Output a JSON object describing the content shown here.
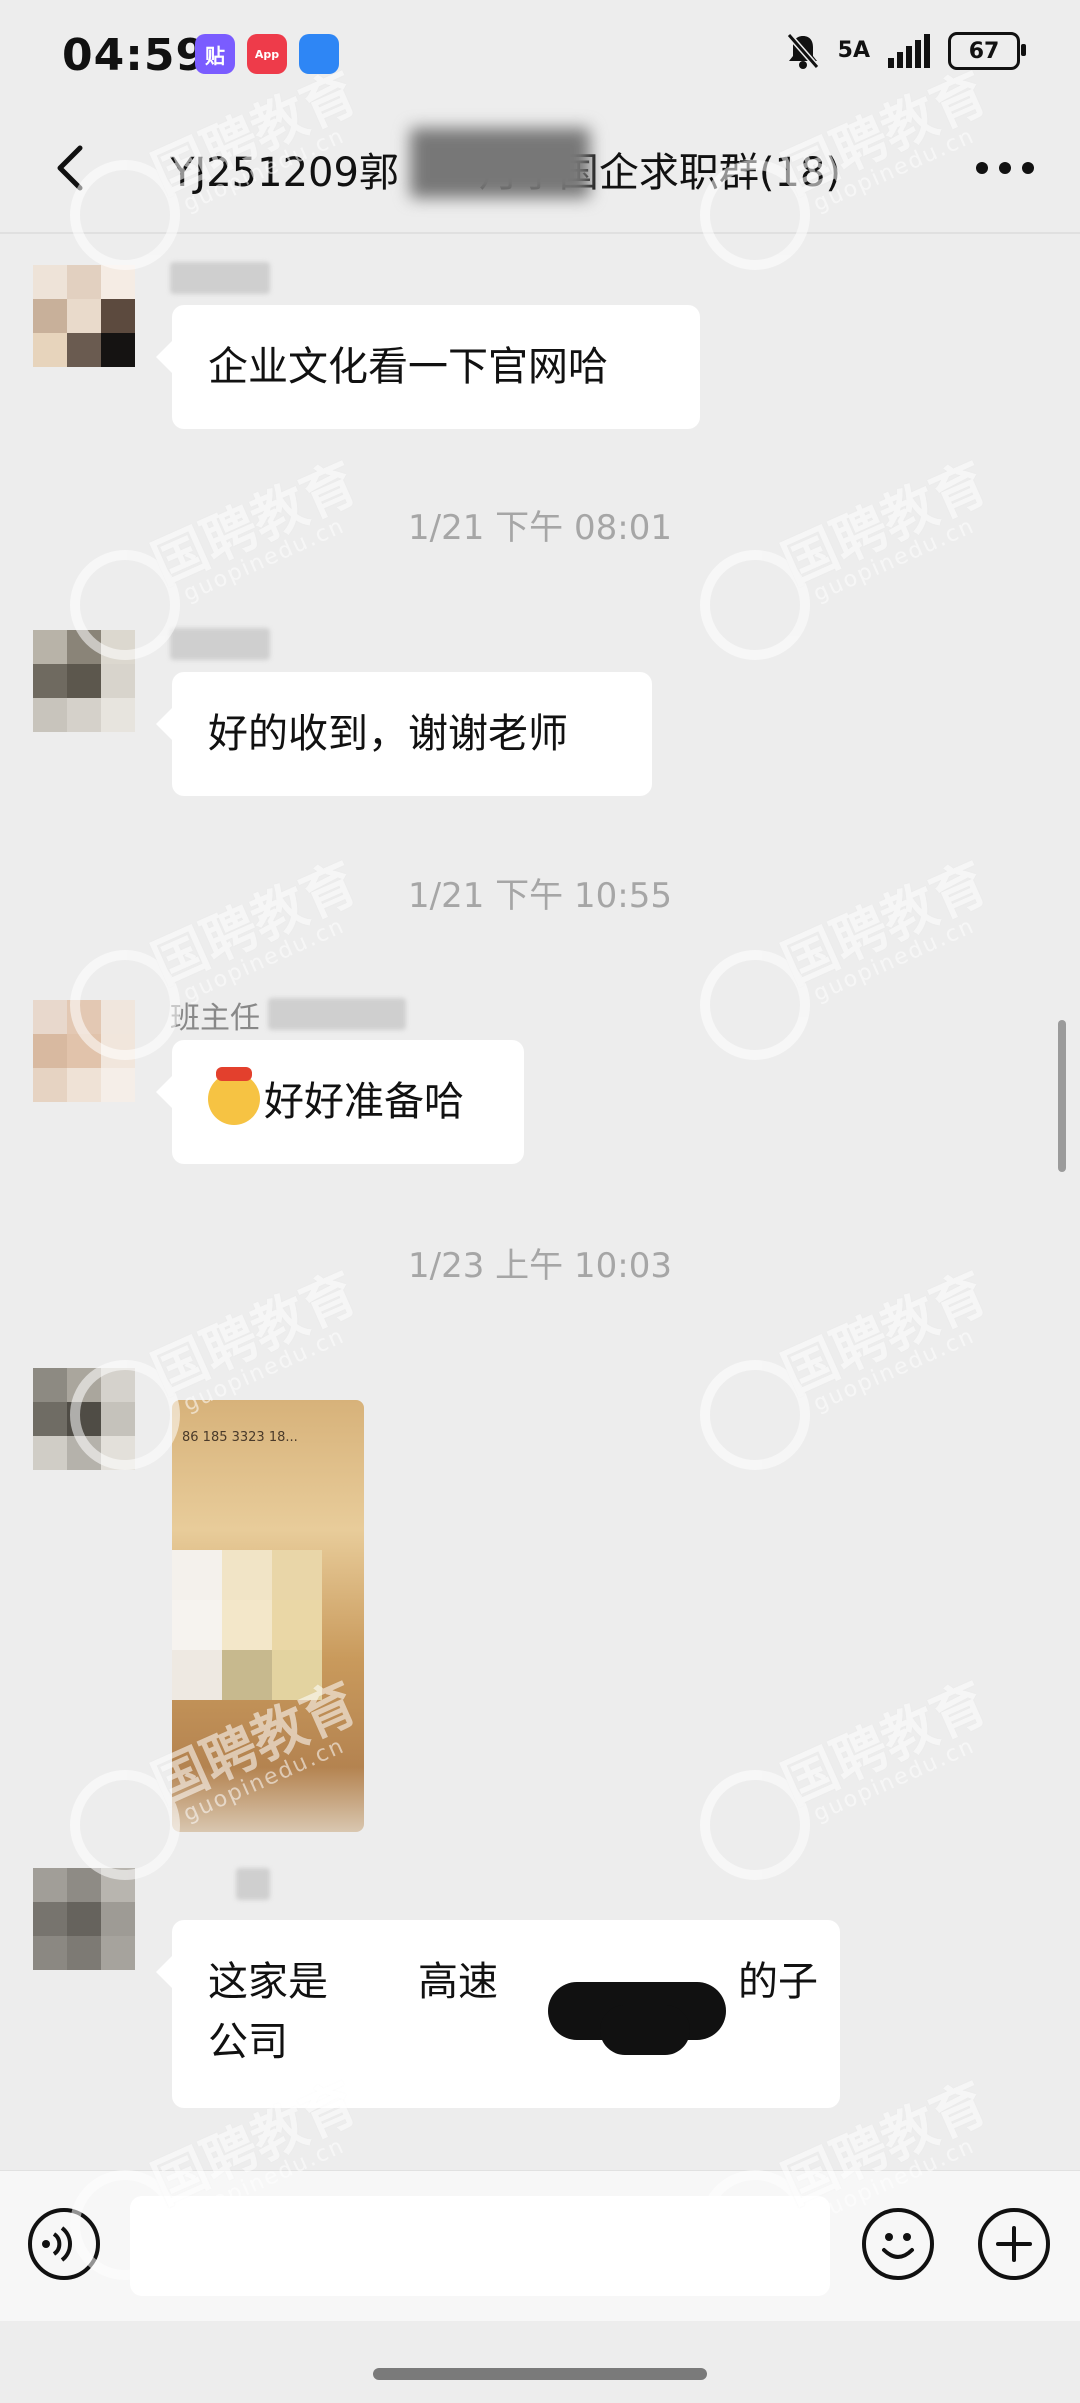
{
  "status_bar": {
    "time": "04:59",
    "app_icons": [
      {
        "label": "贴",
        "color": "#7a5cff"
      },
      {
        "label": "App",
        "color": "#ee3b4a"
      },
      {
        "label": "",
        "color": "#2e86f5"
      }
    ],
    "network": "5A",
    "battery": "67"
  },
  "nav": {
    "title": "YJ251209郭　　月学国企求职群(18)"
  },
  "messages": [
    {
      "text": "企业文化看一下官网哈"
    },
    {
      "text": "好的收到，谢谢老师"
    },
    {
      "sender": "班主任",
      "text": "好好准备哈"
    },
    {
      "image": true,
      "phone_text": "86 185 3323 18..."
    },
    {
      "text_line1": "这家是",
      "text_mid": "高速",
      "text_end": "的子",
      "text_line2": "公司"
    }
  ],
  "timestamps": [
    "1/21 下午 08:01",
    "1/21 下午 10:55",
    "1/23 上午 10:03"
  ],
  "watermark": {
    "cn": "国聘教育",
    "en": "guopinedu.cn"
  },
  "colors": {
    "background": "#ededed",
    "bubble": "#ffffff",
    "timestamp": "#a6a6a6"
  }
}
